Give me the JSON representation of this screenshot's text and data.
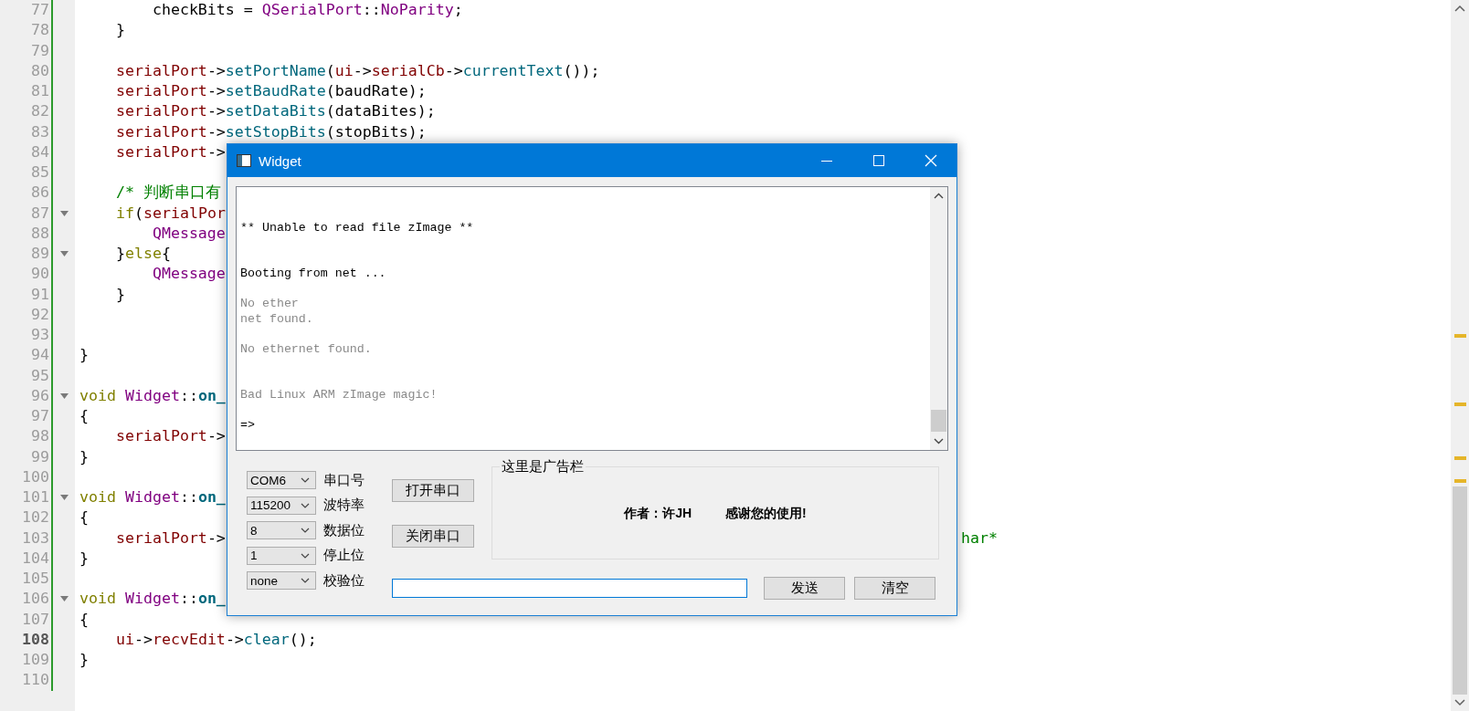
{
  "editor": {
    "lines": [
      {
        "number": "77",
        "foldable": false,
        "current": false,
        "code": [
          {
            "text": "        checkBits = ",
            "kind": "plain"
          },
          {
            "text": "QSerialPort",
            "kind": "type"
          },
          {
            "text": "::",
            "kind": "plain"
          },
          {
            "text": "NoParity",
            "kind": "type"
          },
          {
            "text": ";",
            "kind": "plain"
          }
        ]
      },
      {
        "number": "78",
        "foldable": false,
        "current": false,
        "code": [
          {
            "text": "    }",
            "kind": "plain"
          }
        ]
      },
      {
        "number": "79",
        "foldable": false,
        "current": false
      },
      {
        "number": "80",
        "foldable": false,
        "current": false,
        "code": [
          {
            "text": "    serialPort",
            "kind": "member"
          },
          {
            "text": "->",
            "kind": "plain"
          },
          {
            "text": "setPortName",
            "kind": "func"
          },
          {
            "text": "(",
            "kind": "plain"
          },
          {
            "text": "ui",
            "kind": "member"
          },
          {
            "text": "->",
            "kind": "plain"
          },
          {
            "text": "serialCb",
            "kind": "member"
          },
          {
            "text": "->",
            "kind": "plain"
          },
          {
            "text": "currentText",
            "kind": "func"
          },
          {
            "text": "());",
            "kind": "plain"
          }
        ]
      },
      {
        "number": "81",
        "foldable": false,
        "current": false,
        "code": [
          {
            "text": "    serialPort",
            "kind": "member"
          },
          {
            "text": "->",
            "kind": "plain"
          },
          {
            "text": "setBaudRate",
            "kind": "func"
          },
          {
            "text": "(baudRate);",
            "kind": "plain"
          }
        ]
      },
      {
        "number": "82",
        "foldable": false,
        "current": false,
        "code": [
          {
            "text": "    serialPort",
            "kind": "member"
          },
          {
            "text": "->",
            "kind": "plain"
          },
          {
            "text": "setDataBits",
            "kind": "func"
          },
          {
            "text": "(dataBites);",
            "kind": "plain"
          }
        ]
      },
      {
        "number": "83",
        "foldable": false,
        "current": false,
        "code": [
          {
            "text": "    serialPort",
            "kind": "member"
          },
          {
            "text": "->",
            "kind": "plain"
          },
          {
            "text": "setStopBits",
            "kind": "func"
          },
          {
            "text": "(stopBits);",
            "kind": "plain"
          }
        ]
      },
      {
        "number": "84",
        "foldable": false,
        "current": false,
        "code": [
          {
            "text": "    serialPort",
            "kind": "member"
          },
          {
            "text": "->",
            "kind": "plain"
          }
        ]
      },
      {
        "number": "85",
        "foldable": false,
        "current": false
      },
      {
        "number": "86",
        "foldable": false,
        "current": false,
        "code": [
          {
            "text": "    /* 判断串口有",
            "kind": "comment"
          }
        ]
      },
      {
        "number": "87",
        "foldable": true,
        "current": false,
        "code": [
          {
            "text": "    if",
            "kind": "keyword"
          },
          {
            "text": "(",
            "kind": "plain"
          },
          {
            "text": "serialPor",
            "kind": "member"
          }
        ]
      },
      {
        "number": "88",
        "foldable": false,
        "current": false,
        "code": [
          {
            "text": "        QMessage",
            "kind": "type"
          }
        ]
      },
      {
        "number": "89",
        "foldable": true,
        "current": false,
        "code": [
          {
            "text": "    }",
            "kind": "plain"
          },
          {
            "text": "else",
            "kind": "keyword"
          },
          {
            "text": "{",
            "kind": "plain"
          }
        ]
      },
      {
        "number": "90",
        "foldable": false,
        "current": false,
        "code": [
          {
            "text": "        QMessage",
            "kind": "type"
          }
        ]
      },
      {
        "number": "91",
        "foldable": false,
        "current": false,
        "code": [
          {
            "text": "    }",
            "kind": "plain"
          }
        ]
      },
      {
        "number": "92",
        "foldable": false,
        "current": false
      },
      {
        "number": "93",
        "foldable": false,
        "current": false
      },
      {
        "number": "94",
        "foldable": false,
        "current": false,
        "code": [
          {
            "text": "}",
            "kind": "plain"
          }
        ]
      },
      {
        "number": "95",
        "foldable": false,
        "current": false
      },
      {
        "number": "96",
        "foldable": true,
        "current": false,
        "code": [
          {
            "text": "void ",
            "kind": "keyword"
          },
          {
            "text": "Widget",
            "kind": "type"
          },
          {
            "text": "::",
            "kind": "plain"
          },
          {
            "text": "on_",
            "kind": "funcdef"
          }
        ]
      },
      {
        "number": "97",
        "foldable": false,
        "current": false,
        "code": [
          {
            "text": "{",
            "kind": "plain"
          }
        ]
      },
      {
        "number": "98",
        "foldable": false,
        "current": false,
        "code": [
          {
            "text": "    serialPort",
            "kind": "member"
          },
          {
            "text": "->",
            "kind": "plain"
          }
        ]
      },
      {
        "number": "99",
        "foldable": false,
        "current": false,
        "code": [
          {
            "text": "}",
            "kind": "plain"
          }
        ]
      },
      {
        "number": "100",
        "foldable": false,
        "current": false
      },
      {
        "number": "101",
        "foldable": true,
        "current": false,
        "code": [
          {
            "text": "void ",
            "kind": "keyword"
          },
          {
            "text": "Widget",
            "kind": "type"
          },
          {
            "text": "::",
            "kind": "plain"
          },
          {
            "text": "on_",
            "kind": "funcdef"
          }
        ]
      },
      {
        "number": "102",
        "foldable": false,
        "current": false,
        "code": [
          {
            "text": "{",
            "kind": "plain"
          }
        ]
      },
      {
        "number": "103",
        "foldable": false,
        "current": false,
        "code": [
          {
            "text": "    serialPort",
            "kind": "member"
          },
          {
            "text": "->",
            "kind": "plain"
          }
        ],
        "tail": [
          {
            "text": "har*",
            "kind": "comment"
          }
        ]
      },
      {
        "number": "104",
        "foldable": false,
        "current": false,
        "code": [
          {
            "text": "}",
            "kind": "plain"
          }
        ]
      },
      {
        "number": "105",
        "foldable": false,
        "current": false
      },
      {
        "number": "106",
        "foldable": true,
        "current": false,
        "code": [
          {
            "text": "void ",
            "kind": "keyword"
          },
          {
            "text": "Widget",
            "kind": "type"
          },
          {
            "text": "::",
            "kind": "plain"
          },
          {
            "text": "on_",
            "kind": "funcdef"
          }
        ]
      },
      {
        "number": "107",
        "foldable": false,
        "current": false,
        "code": [
          {
            "text": "{",
            "kind": "plain"
          }
        ]
      },
      {
        "number": "108",
        "foldable": false,
        "current": true,
        "code": [
          {
            "text": "    ui",
            "kind": "member"
          },
          {
            "text": "->",
            "kind": "plain"
          },
          {
            "text": "recvEdit",
            "kind": "member"
          },
          {
            "text": "->",
            "kind": "plain"
          },
          {
            "text": "clear",
            "kind": "func"
          },
          {
            "text": "();",
            "kind": "plain"
          }
        ]
      },
      {
        "number": "109",
        "foldable": false,
        "current": false,
        "code": [
          {
            "text": "}",
            "kind": "plain"
          }
        ]
      },
      {
        "number": "110",
        "foldable": false,
        "current": false
      }
    ]
  },
  "window": {
    "title": "Widget",
    "console": [
      {
        "kind": "blank"
      },
      {
        "kind": "blank"
      },
      {
        "kind": "text",
        "text": "** Unable to read file zImage **",
        "dim": false
      },
      {
        "kind": "blank"
      },
      {
        "kind": "blank"
      },
      {
        "kind": "text",
        "text": "Booting from net ...",
        "dim": false
      },
      {
        "kind": "blank"
      },
      {
        "kind": "text",
        "text": "No ether",
        "dim": true
      },
      {
        "kind": "text",
        "text": "net found.",
        "dim": true
      },
      {
        "kind": "blank"
      },
      {
        "kind": "text",
        "text": "No ethernet found.",
        "dim": true
      },
      {
        "kind": "blank"
      },
      {
        "kind": "blank"
      },
      {
        "kind": "text",
        "text": "Bad Linux ARM zImage magic!",
        "dim": true
      },
      {
        "kind": "blank"
      },
      {
        "kind": "text",
        "text": "=>",
        "dim": false
      }
    ],
    "settings": [
      {
        "value": "COM6",
        "label": "串口号"
      },
      {
        "value": "115200",
        "label": "波特率"
      },
      {
        "value": "8",
        "label": "数据位"
      },
      {
        "value": "1",
        "label": "停止位"
      },
      {
        "value": "none",
        "label": "校验位"
      }
    ],
    "open_button": "打开串口",
    "close_button": "关闭串口",
    "ad_box": {
      "title": "这里是广告栏",
      "author": "作者：许JH",
      "thanks": "感谢您的使用!"
    },
    "send_field": {
      "focused": true
    },
    "send_button": "发送",
    "clear_button": "清空"
  }
}
